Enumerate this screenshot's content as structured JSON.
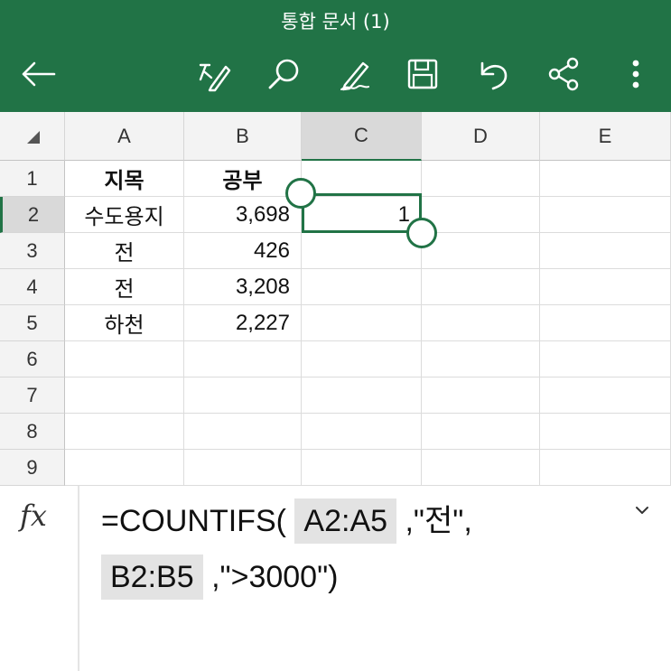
{
  "app": {
    "title": "통합 문서 (1)",
    "accent": "#217346",
    "toolbar_icons": [
      "back-arrow-icon",
      "edit-text-icon",
      "search-icon",
      "pen-icon",
      "save-icon",
      "undo-icon",
      "share-icon",
      "more-icon"
    ]
  },
  "sheet": {
    "columns": [
      "A",
      "B",
      "C",
      "D",
      "E"
    ],
    "rows": [
      "1",
      "2",
      "3",
      "4",
      "5",
      "6",
      "7",
      "8",
      "9"
    ],
    "selected_cell": "C2",
    "cells": {
      "A1": "지목",
      "B1": "공부",
      "A2": "수도용지",
      "B2": "3,698",
      "C2": "1",
      "A3": "전",
      "B3": "426",
      "A4": "전",
      "B4": "3,208",
      "A5": "하천",
      "B5": "2,227"
    }
  },
  "formula_bar": {
    "fx_label": "fx",
    "prefix": "=COUNTIFS(",
    "ref1": "A2:A5",
    "middle": ",\"전\",",
    "ref2": "B2:B5",
    "suffix": ",\">3000\")"
  }
}
